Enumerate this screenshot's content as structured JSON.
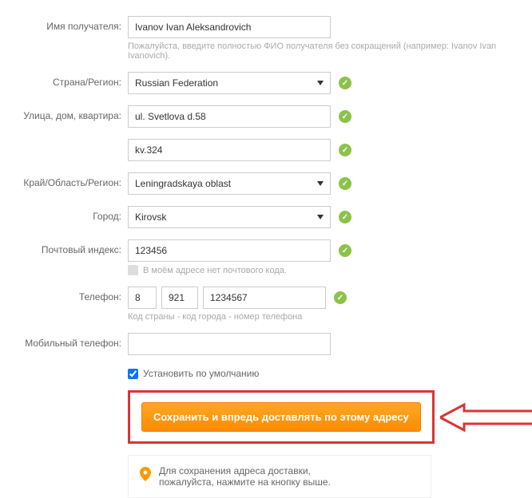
{
  "labels": {
    "recipient": "Имя получателя:",
    "country": "Страна/Регион:",
    "street": "Улица, дом, квартира:",
    "region": "Край/Область/Регион:",
    "city": "Город:",
    "postal": "Почтовый индекс:",
    "phone": "Телефон:",
    "mobile": "Мобильный телефон:"
  },
  "values": {
    "recipient": "Ivanov Ivan Aleksandrovich",
    "country": "Russian Federation",
    "street1": "ul. Svetlova d.58",
    "street2": "kv.324",
    "region": "Leningradskaya oblast",
    "city": "Kirovsk",
    "postal": "123456",
    "phone_country": "8",
    "phone_area": "921",
    "phone_number": "1234567",
    "mobile": ""
  },
  "hints": {
    "recipient": "Пожалуйста, введите полностью ФИО получателя без сокращений (например: Ivanov Ivan Ivanovich).",
    "no_postal": "В моём адресе нет почтового кода.",
    "phone": "Код страны - код города - номер телефона"
  },
  "checkbox": {
    "default_label": "Установить по умолчанию",
    "default_checked": true
  },
  "button": {
    "submit": "Сохранить и впредь доставлять по этому адресу"
  },
  "info": {
    "line1": "Для сохранения адреса доставки,",
    "line2": "пожалуйста, нажмите на кнопку выше."
  }
}
